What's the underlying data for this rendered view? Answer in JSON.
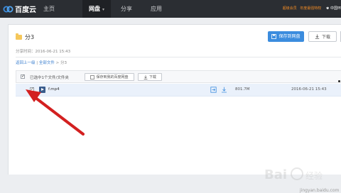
{
  "topbar": {
    "brand": "百度云",
    "nav": [
      {
        "label": "主页"
      },
      {
        "label": "网盘"
      },
      {
        "label": "分享"
      },
      {
        "label": "应用"
      }
    ],
    "vip_text": "超级会员",
    "promo_text": "年度最强特权",
    "user_text": "中国环",
    "bg_color": "#2b2e33",
    "vip_color": "#f08a24"
  },
  "folder": {
    "title": "分3",
    "share_time": "分享时间：2016-06-21 15:43",
    "save_button": "保存到网盘",
    "download_button": "下载"
  },
  "breadcrumb": {
    "back": "返回上一级",
    "divider": "|",
    "all_files": "全部文件",
    "separator": ">",
    "current": "分3"
  },
  "toolbar": {
    "selected_text": "已选中1个文件/文件夹",
    "save_button": "保存到我的百度网盘",
    "download_button": "下载"
  },
  "files": [
    {
      "name": "f.mp4",
      "size": "801.7M",
      "date": "2016-06-21 15:43",
      "checked": true
    }
  ],
  "watermark": {
    "text": "jingyan.baidu.com"
  },
  "colors": {
    "accent": "#3b8cde",
    "arrow": "#d32020",
    "row_highlight": "#eaf1fb"
  }
}
